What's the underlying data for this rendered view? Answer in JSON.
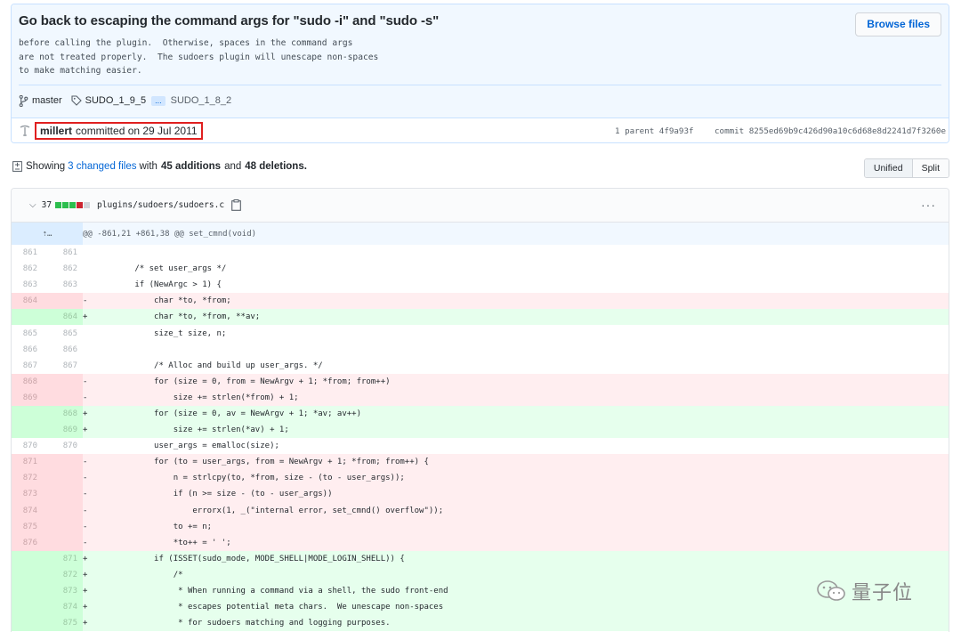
{
  "commit": {
    "title": "Go back to escaping the command args for \"sudo -i\" and \"sudo -s\"",
    "description": "before calling the plugin.  Otherwise, spaces in the command args\nare not treated properly.  The sudoers plugin will unescape non-spaces\nto make matching easier.",
    "browse_files_label": "Browse files",
    "branch": "master",
    "tag_first": "SUDO_1_9_5",
    "tag_ellipsis": "...",
    "tag_last": "SUDO_1_8_2",
    "author": "millert",
    "committed_text": "committed on 29 Jul 2011",
    "parent_text": "1 parent 4f9a93f",
    "commit_sha_text": "commit 8255ed69b9c426d90a10c6d68e8d2241d7f3260e"
  },
  "summary": {
    "showing": "Showing",
    "changed_files": "3 changed files",
    "with": "with",
    "additions": "45 additions",
    "and": "and",
    "deletions": "48 deletions.",
    "unified_label": "Unified",
    "split_label": "Split"
  },
  "file": {
    "count": "37",
    "path": "plugins/sudoers/sudoers.c",
    "more_label": "···",
    "hunk_header": "@@ -861,21 +861,38 @@ set_cmnd(void)",
    "diffstat_colors": [
      "#2cbe4e",
      "#2cbe4e",
      "#2cbe4e",
      "#cb2431",
      "#d1d5da"
    ]
  },
  "diff_rows": [
    {
      "type": "ctx",
      "old": "861",
      "new": "861",
      "mark": "",
      "code": ""
    },
    {
      "type": "ctx",
      "old": "862",
      "new": "862",
      "mark": "",
      "code": "        /* set user_args */"
    },
    {
      "type": "ctx",
      "old": "863",
      "new": "863",
      "mark": "",
      "code": "        if (NewArgc > 1) {"
    },
    {
      "type": "del",
      "old": "864",
      "new": "",
      "mark": "-",
      "code": "            char *to, *from;"
    },
    {
      "type": "add",
      "old": "",
      "new": "864",
      "mark": "+",
      "code": "            char *to, *from, **av;"
    },
    {
      "type": "ctx",
      "old": "865",
      "new": "865",
      "mark": "",
      "code": "            size_t size, n;"
    },
    {
      "type": "ctx",
      "old": "866",
      "new": "866",
      "mark": "",
      "code": ""
    },
    {
      "type": "ctx",
      "old": "867",
      "new": "867",
      "mark": "",
      "code": "            /* Alloc and build up user_args. */"
    },
    {
      "type": "del",
      "old": "868",
      "new": "",
      "mark": "-",
      "code": "            for (size = 0, from = NewArgv + 1; *from; from++)"
    },
    {
      "type": "del",
      "old": "869",
      "new": "",
      "mark": "-",
      "code": "                size += strlen(*from) + 1;"
    },
    {
      "type": "add",
      "old": "",
      "new": "868",
      "mark": "+",
      "code": "            for (size = 0, av = NewArgv + 1; *av; av++)"
    },
    {
      "type": "add",
      "old": "",
      "new": "869",
      "mark": "+",
      "code": "                size += strlen(*av) + 1;"
    },
    {
      "type": "ctx",
      "old": "870",
      "new": "870",
      "mark": "",
      "code": "            user_args = emalloc(size);"
    },
    {
      "type": "del",
      "old": "871",
      "new": "",
      "mark": "-",
      "code": "            for (to = user_args, from = NewArgv + 1; *from; from++) {"
    },
    {
      "type": "del",
      "old": "872",
      "new": "",
      "mark": "-",
      "code": "                n = strlcpy(to, *from, size - (to - user_args));"
    },
    {
      "type": "del",
      "old": "873",
      "new": "",
      "mark": "-",
      "code": "                if (n >= size - (to - user_args))"
    },
    {
      "type": "del",
      "old": "874",
      "new": "",
      "mark": "-",
      "code": "                    errorx(1, _(\"internal error, set_cmnd() overflow\"));"
    },
    {
      "type": "del",
      "old": "875",
      "new": "",
      "mark": "-",
      "code": "                to += n;"
    },
    {
      "type": "del",
      "old": "876",
      "new": "",
      "mark": "-",
      "code": "                *to++ = ' ';"
    },
    {
      "type": "add",
      "old": "",
      "new": "871",
      "mark": "+",
      "code": "            if (ISSET(sudo_mode, MODE_SHELL|MODE_LOGIN_SHELL)) {"
    },
    {
      "type": "add",
      "old": "",
      "new": "872",
      "mark": "+",
      "code": "                /*"
    },
    {
      "type": "add",
      "old": "",
      "new": "873",
      "mark": "+",
      "code": "                 * When running a command via a shell, the sudo front-end"
    },
    {
      "type": "add",
      "old": "",
      "new": "874",
      "mark": "+",
      "code": "                 * escapes potential meta chars.  We unescape non-spaces"
    },
    {
      "type": "add",
      "old": "",
      "new": "875",
      "mark": "+",
      "code": "                 * for sudoers matching and logging purposes."
    }
  ],
  "watermark": {
    "text": "量子位"
  }
}
